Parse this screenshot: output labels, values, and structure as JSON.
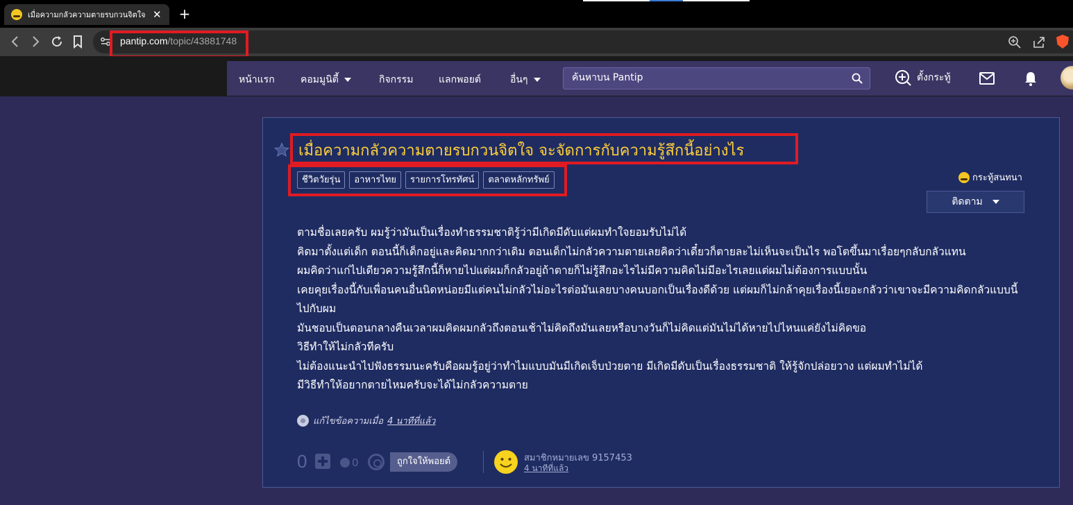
{
  "browser": {
    "tab_title": "เมื่อความกลัวความตายรบกวนจิตใจ จะ",
    "close_label": "✕",
    "new_tab_label": "+",
    "url_host": "pantip.com",
    "url_path": "/topic/43881748"
  },
  "nav": {
    "items": [
      {
        "label": "หน้าแรก"
      },
      {
        "label": "คอมมูนิตี้"
      },
      {
        "label": "กิจกรรม"
      },
      {
        "label": "แลกพอยต์"
      },
      {
        "label": "อื่นๆ"
      }
    ],
    "search_placeholder": "ค้นหาบน Pantip",
    "post_label": "ตั้งกระทู้"
  },
  "topic": {
    "title": "เมื่อความกลัวความตายรบกวนจิตใจ จะจัดการกับความรู้สึกนี้อย่างไร",
    "tags": [
      "ชีวิตวัยรุ่น",
      "อาหารไทย",
      "รายการโทรทัศน์",
      "ตลาดหลักทรัพย์"
    ],
    "kind": "กระทู้สนทนา",
    "follow_label": "ติดตาม",
    "body": [
      "ตามชื่อเลยครับ ผมรู้ว่ามันเป็นเรื่องทำธรรมชาติรู้ว่ามีเกิดมีดับแต่ผมทำใจยอมรับไม่ได้",
      "คิดมาตั้งแต่เด็ก ตอนนี้ก็เด็กอยู่และคิดมากกว่าเดิม ตอนเด็กไม่กลัวความตายเลยคิดว่าเดี๋ยวก็ตายละไม่เห็นจะเป็นไร พอโตขึ้นมาเรื่อยๆกลับกลัวแทน",
      "ผมคิดว่าแก่ไปเดียวความรู้สึกนี้ก็หายไปแต่ผมก็กลัวอยู่ถ้าตายก็ไม่รู้สึกอะไรไม่มีความคิดไม่มีอะไรเลยแต่ผมไม่ต้องการแบบนั้น",
      "เคยคุยเรื่องนี้กับเพื่อนคนอื่นนิดหน่อยมีแต่คนไม่กลัวไม่อะไรต่อมันเลยบางคนบอกเป็นเรื่องดีด้วย แต่ผมก็ไม่กล้าคุยเรื่องนี้เยอะกลัวว่าเขาจะมีความคิดกลัวแบบนี้ไปกับผม",
      "มันชอบเป็นตอนกลางคืนเวลาผมคิดผมกลัวถึงตอนเช้าไม่คิดถึงมันเลยหรือบางวันก็ไม่คิดแต่มันไม่ได้หายไปไหนแค่ยังไม่คิดขอ",
      "วิธีทำให้ไม่กลัวทีครับ",
      "ไม่ต้องแนะนำไปฟังธรรมนะครับคือผมรู้อยู่ว่าทำไมแบบมันมีเกิดเจ็บป่วยตาย มีเกิดมีดับเป็นเรื่องธรรมชาติ ให้รู้จักปล่อยวาง แต่ผมทำไม่ได้",
      "มีวิธีทำให้อยากตายไหมครับจะได้ไม่กลัวความตาย"
    ],
    "edited_prefix": "แก้ไขข้อความเมื่อ",
    "edited_time": "4 นาทีที่แล้ว"
  },
  "footer": {
    "vote_count": "0",
    "emotion_count": "0",
    "like_label": "ถูกใจให้พอยต์",
    "member": "สมาชิกหมายเลข 9157453",
    "posted_ago": "4 นาทีที่แล้ว"
  },
  "colors": {
    "title": "#ffcf38",
    "card_bg": "#1f2c62",
    "page_bg": "#2f2b58",
    "highlight": "#e01b22"
  },
  "icons": [
    "back-icon",
    "forward-icon",
    "reload-icon",
    "bookmark-icon",
    "site-info-icon",
    "zoom-icon",
    "share-icon",
    "brave-icon",
    "search-icon",
    "add-post-icon",
    "mail-icon",
    "bell-icon",
    "star-icon",
    "smile-icon"
  ]
}
